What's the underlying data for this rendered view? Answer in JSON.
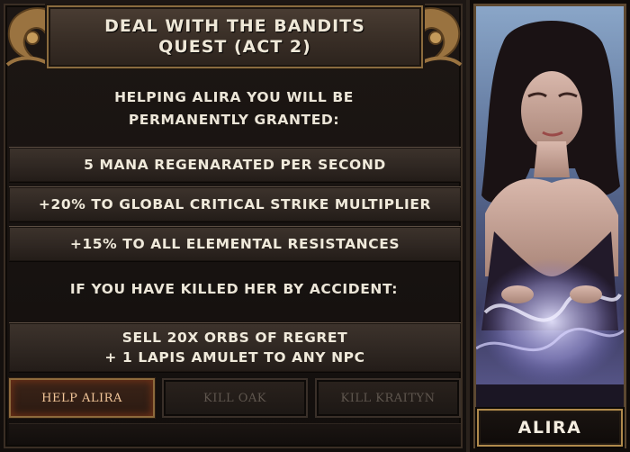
{
  "quest": {
    "title_line1": "DEAL WITH THE BANDITS",
    "title_line2": "QUEST (ACT 2)",
    "intro_line1": "HELPING ALIRA YOU WILL BE",
    "intro_line2": "PERMANENTLY GRANTED:",
    "rewards": [
      "5 MANA REGENARATED PER SECOND",
      "+20% TO GLOBAL CRITICAL STRIKE MULTIPLIER",
      "+15% TO ALL ELEMENTAL RESISTANCES"
    ],
    "accident_text": "IF YOU HAVE KILLED HER BY ACCIDENT:",
    "accident_fix_line1": "SELL 20X ORBS OF REGRET",
    "accident_fix_line2": "+ 1 LAPIS AMULET TO ANY NPC"
  },
  "buttons": {
    "help": "HELP ALIRA",
    "kill_oak": "KILL OAK",
    "kill_kraityn": "KILL KRAITYN"
  },
  "portrait": {
    "name": "ALIRA"
  },
  "icons": {
    "left_ornament": "scroll-ornament-icon",
    "right_ornament": "scroll-ornament-icon"
  },
  "colors": {
    "gold_border": "#8a6b3e",
    "active_button_text": "#f3c79a",
    "text": "#ece6d8"
  }
}
